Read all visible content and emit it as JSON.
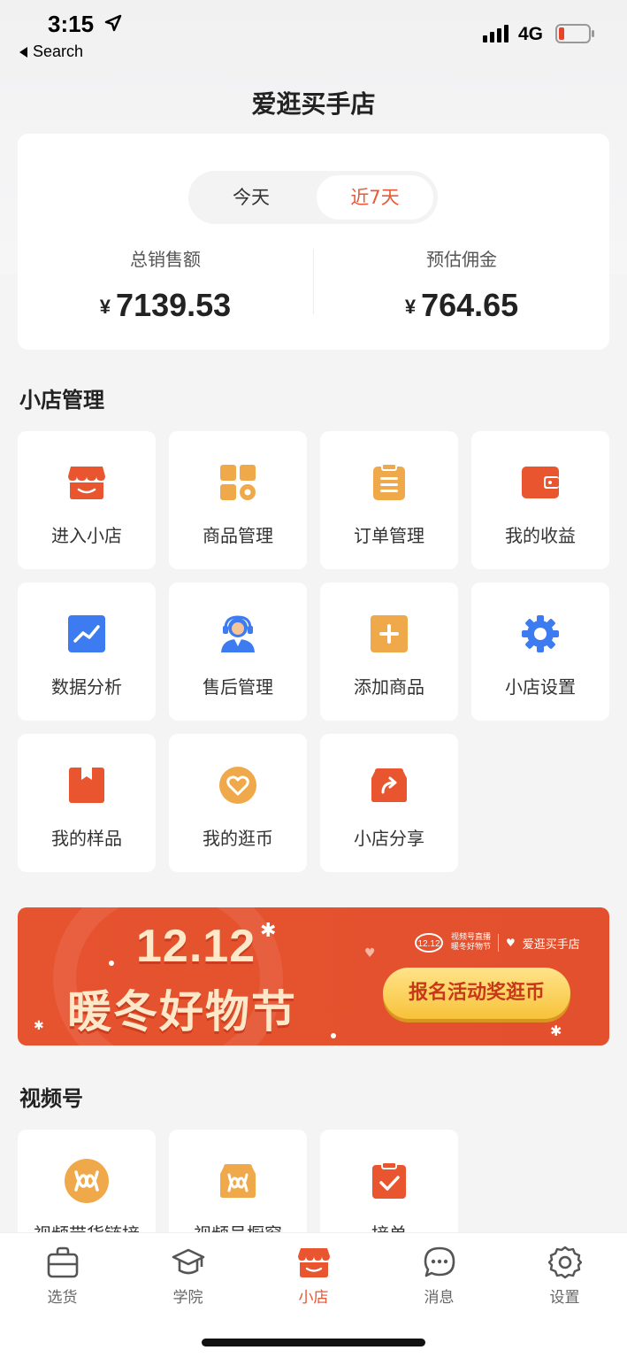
{
  "status_bar": {
    "time": "3:15",
    "back_label": "Search",
    "network": "4G"
  },
  "page_title": "爱逛买手店",
  "stats": {
    "tabs": [
      "今天",
      "近7天"
    ],
    "selected_tab": "近7天",
    "currency": "¥",
    "total_sales": {
      "label": "总销售额",
      "value": "7139.53"
    },
    "estimated_commission": {
      "label": "预估佣金",
      "value": "764.65"
    }
  },
  "shop_management": {
    "title": "小店管理",
    "items": [
      {
        "label": "进入小店",
        "icon": "storefront-icon"
      },
      {
        "label": "商品管理",
        "icon": "product-grid-gear-icon"
      },
      {
        "label": "订单管理",
        "icon": "clipboard-icon"
      },
      {
        "label": "我的收益",
        "icon": "wallet-icon"
      },
      {
        "label": "数据分析",
        "icon": "trend-chart-icon"
      },
      {
        "label": "售后管理",
        "icon": "customer-service-icon"
      },
      {
        "label": "添加商品",
        "icon": "add-square-icon"
      },
      {
        "label": "小店设置",
        "icon": "gear-icon"
      },
      {
        "label": "我的样品",
        "icon": "sample-box-icon"
      },
      {
        "label": "我的逛币",
        "icon": "heart-coin-icon"
      },
      {
        "label": "小店分享",
        "icon": "share-bag-icon"
      }
    ]
  },
  "banner": {
    "date": "12.12",
    "title": "暖冬好物节",
    "brand_mini_line1": "视频号直播",
    "brand_mini_line2": "暖冬好物节",
    "brand_shop": "爱逛买手店",
    "cta": "报名活动奖逛币"
  },
  "video_section": {
    "title": "视频号",
    "items": [
      {
        "label": "视频带货链接",
        "icon": "channels-logo-icon"
      },
      {
        "label": "视频号橱窗",
        "icon": "channels-shop-icon"
      },
      {
        "label": "接单",
        "icon": "check-clipboard-icon"
      }
    ]
  },
  "tabbar": {
    "items": [
      {
        "label": "选货",
        "icon": "bag-icon"
      },
      {
        "label": "学院",
        "icon": "graduation-cap-icon"
      },
      {
        "label": "小店",
        "icon": "store-icon"
      },
      {
        "label": "消息",
        "icon": "chat-bubble-icon"
      },
      {
        "label": "设置",
        "icon": "settings-icon"
      }
    ],
    "active": "小店"
  },
  "colors": {
    "accent": "#e8552f",
    "orange": "#f0a94a",
    "blue": "#3d7cf0"
  }
}
